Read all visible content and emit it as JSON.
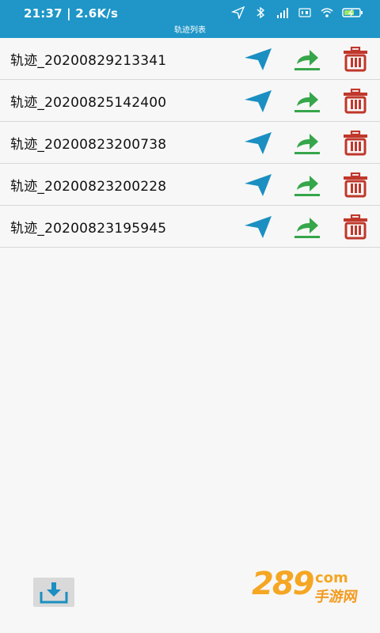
{
  "status_bar": {
    "time_speed": "21:37 | 2.6K/s",
    "icons": [
      "location-arrow-icon",
      "bluetooth-icon",
      "signal-icon",
      "hd-icon",
      "wifi-icon",
      "battery-icon"
    ]
  },
  "header": {
    "title": "轨迹列表"
  },
  "tracks": [
    {
      "name": "轨迹_20200829213341"
    },
    {
      "name": "轨迹_20200825142400"
    },
    {
      "name": "轨迹_20200823200738"
    },
    {
      "name": "轨迹_20200823200228"
    },
    {
      "name": "轨迹_20200823195945"
    }
  ],
  "row_actions": [
    "navigate-icon",
    "share-icon",
    "delete-icon"
  ],
  "colors": {
    "header_bg": "#1f96c7",
    "navigate": "#1b8fc1",
    "share": "#36a64a",
    "delete": "#c0372b",
    "watermark": "#f5a623"
  },
  "watermark": {
    "main": "289",
    "domain": "com",
    "sub": "手游网"
  }
}
